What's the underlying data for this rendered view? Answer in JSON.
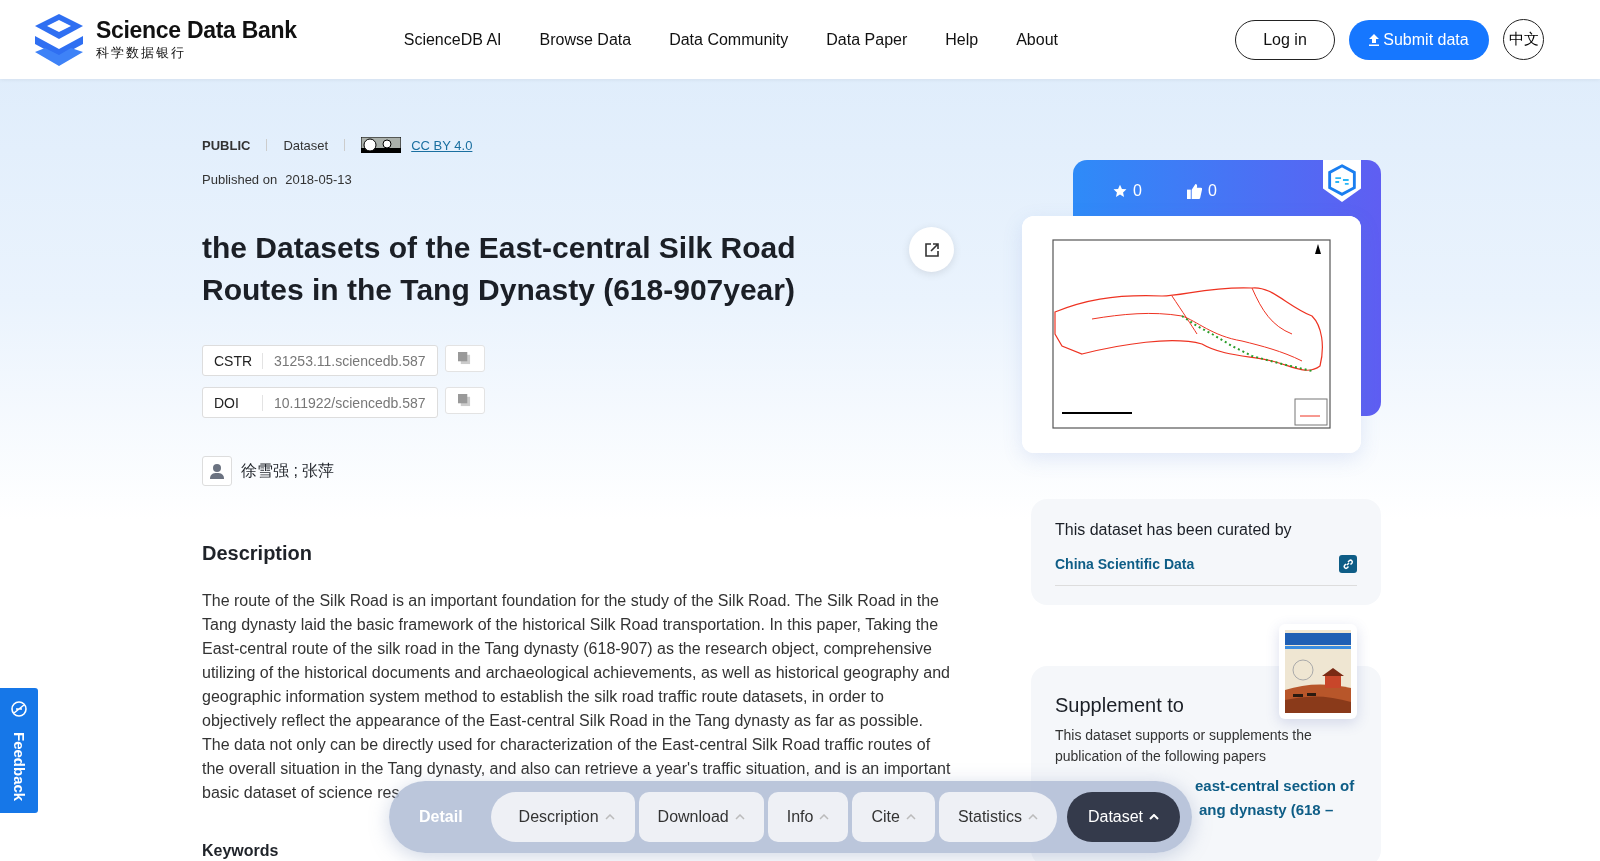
{
  "header": {
    "logo_title": "Science Data Bank",
    "logo_subtitle": "科学数据银行",
    "nav": [
      {
        "label": "ScienceDB AI"
      },
      {
        "label": "Browse Data"
      },
      {
        "label": "Data Community"
      },
      {
        "label": "Data Paper"
      },
      {
        "label": "Help"
      },
      {
        "label": "About"
      }
    ],
    "login": "Log in",
    "submit": "Submit data",
    "language": "中文"
  },
  "dataset": {
    "access": "PUBLIC",
    "type": "Dataset",
    "license": "CC BY 4.0",
    "published_label": "Published on",
    "published_date": "2018-05-13",
    "title": "the Datasets of the East-central Silk Road Routes in the Tang Dynasty (618-907year)",
    "identifiers": [
      {
        "label": "CSTR",
        "value": "31253.11.sciencedb.587"
      },
      {
        "label": "DOI",
        "value": "10.11922/sciencedb.587"
      }
    ],
    "authors": "徐雪强 ; 张萍",
    "description_heading": "Description",
    "description": "The route of the Silk Road is an important foundation for the study of the Silk Road. The Silk Road in the Tang dynasty laid the basic framework of the historical Silk Road transportation. In this paper, Taking the East-central route of the silk road in the Tang dynasty (618-907) as the research object, comprehensive utilizing of the historical documents and archaeological achievements, as well as historical geography and geographic information system method to establish the silk road traffic route datasets, in order to objectively reflect the appearance of the East-central Silk Road in the Tang dynasty as far as possible. The data not only can be directly used for characterization of the East-central Silk Road traffic routes of the overall situation in the Tang dynasty, and also can retrieve a year's traffic situation, and is an important",
    "description_tail": "basic dataset of science res",
    "keywords_heading": "Keywords"
  },
  "stats": {
    "favorites": "0",
    "likes": "0"
  },
  "curation": {
    "heading": "This dataset has been curated by",
    "organization": "China Scientific Data"
  },
  "supplement": {
    "heading": "Supplement to",
    "text": "This dataset supports or supplements the publication of the following papers",
    "paper_lines": [
      "east-central section of",
      "ang dynasty (618 –"
    ]
  },
  "dock": {
    "label": "Detail",
    "tabs": [
      {
        "label": "Description",
        "selected": false
      },
      {
        "label": "Download",
        "selected": false
      },
      {
        "label": "Info",
        "selected": false
      },
      {
        "label": "Cite",
        "selected": false
      },
      {
        "label": "Statistics",
        "selected": false
      },
      {
        "label": "Dataset",
        "selected": true
      }
    ]
  },
  "feedback": "Feedback"
}
